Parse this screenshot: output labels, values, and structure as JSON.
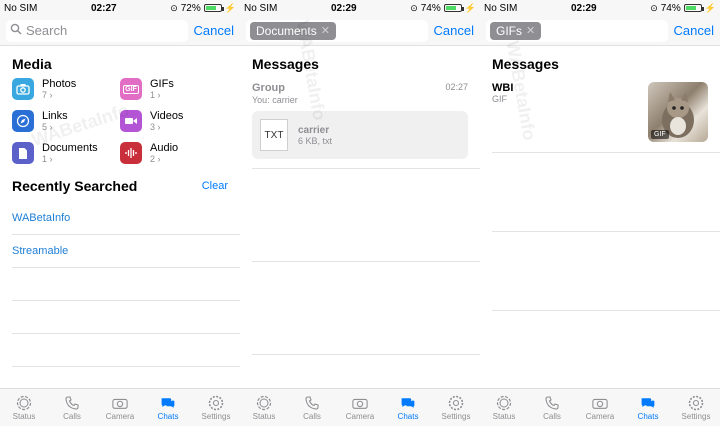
{
  "panels": [
    {
      "status": {
        "carrier": "No SIM",
        "time": "02:27",
        "battery": "72%",
        "battery_fraction": 0.72
      },
      "search": {
        "placeholder": "Search",
        "cancel": "Cancel"
      },
      "media": {
        "title": "Media",
        "items": [
          {
            "label": "Photos",
            "count": "7",
            "icon": "camera-icon",
            "color": "#39a7e0"
          },
          {
            "label": "GIFs",
            "count": "1",
            "icon": "gif-icon",
            "color": "#e26dc5"
          },
          {
            "label": "Links",
            "count": "5",
            "icon": "compass-icon",
            "color": "#2a6fd6"
          },
          {
            "label": "Videos",
            "count": "3",
            "icon": "video-icon",
            "color": "#b455d6"
          },
          {
            "label": "Documents",
            "count": "1",
            "icon": "document-icon",
            "color": "#5b61c9"
          },
          {
            "label": "Audio",
            "count": "2",
            "icon": "audio-icon",
            "color": "#c92f3b"
          }
        ]
      },
      "recent": {
        "title": "Recently Searched",
        "clear": "Clear",
        "items": [
          "WABetaInfo",
          "Streamable"
        ]
      },
      "watermark": "WABetaInfo"
    },
    {
      "status": {
        "carrier": "No SIM",
        "time": "02:29",
        "battery": "74%",
        "battery_fraction": 0.74
      },
      "search": {
        "token": "Documents",
        "cancel": "Cancel"
      },
      "messages": {
        "title": "Messages",
        "group": "Group",
        "time": "02:27",
        "sub": "You: carrier",
        "doc": {
          "type": "TXT",
          "name": "carrier",
          "meta": "6 KB, txt"
        }
      },
      "watermark": "WABetaInfo"
    },
    {
      "status": {
        "carrier": "No SIM",
        "time": "02:29",
        "battery": "74%",
        "battery_fraction": 0.74
      },
      "search": {
        "token": "GIFs",
        "cancel": "Cancel"
      },
      "messages": {
        "title": "Messages",
        "name": "WBI",
        "type": "GIF",
        "badge": "GIF"
      },
      "watermark": "WABetaInfo"
    }
  ],
  "tabbar": [
    {
      "label": "Status",
      "icon": "status-icon"
    },
    {
      "label": "Calls",
      "icon": "phone-icon"
    },
    {
      "label": "Camera",
      "icon": "camera-icon"
    },
    {
      "label": "Chats",
      "icon": "chats-icon",
      "active": true
    },
    {
      "label": "Settings",
      "icon": "gear-icon"
    }
  ],
  "colors": {
    "accent": "#007aff",
    "tab_inactive": "#8e8e93",
    "link": "#1e7fd6"
  }
}
